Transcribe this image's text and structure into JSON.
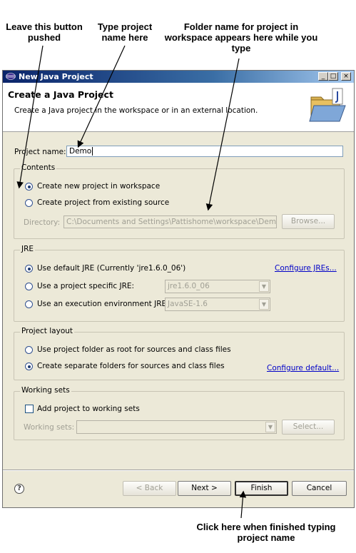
{
  "annotations": {
    "leave_button": "Leave this button pushed",
    "type_name": "Type project name here",
    "folder_name": "Folder name for project in workspace appears here while you type",
    "click_finish": "Click here when finished typing project name"
  },
  "window": {
    "title": "New Java Project",
    "controls": [
      "_",
      "□",
      "×"
    ]
  },
  "header": {
    "title": "Create a Java Project",
    "description": "Create a Java project in the workspace or in an external location.",
    "icon": "java-project-folder-icon"
  },
  "project_name": {
    "label": "Project name:",
    "value": "Demo"
  },
  "contents": {
    "title": "Contents",
    "option_new": "Create new project in workspace",
    "option_existing": "Create project from existing source",
    "selected": "option_new",
    "directory_label": "Directory:",
    "directory_value": "C:\\Documents and Settings\\Pattishome\\workspace\\Demo",
    "browse_label": "Browse..."
  },
  "jre": {
    "title": "JRE",
    "option_default": "Use default JRE (Currently 'jre1.6.0_06')",
    "option_specific": "Use a project specific JRE:",
    "option_env": "Use an execution environment JRE:",
    "specific_value": "jre1.6.0_06",
    "env_value": "JavaSE-1.6",
    "configure_link": "Configure JREs..."
  },
  "layout": {
    "title": "Project layout",
    "option_root": "Use project folder as root for sources and class files",
    "option_separate": "Create separate folders for sources and class files",
    "configure_link": "Configure default..."
  },
  "working_sets": {
    "title": "Working sets",
    "add_label": "Add project to working sets",
    "sets_label": "Working sets:",
    "select_label": "Select..."
  },
  "footer": {
    "help": "?",
    "back": "< Back",
    "next": "Next >",
    "finish": "Finish",
    "cancel": "Cancel"
  }
}
